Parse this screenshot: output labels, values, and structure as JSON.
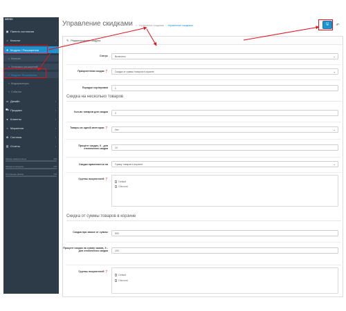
{
  "sidebar": {
    "menu_label": "МЕНЮ",
    "items": [
      {
        "label": "Панель состояния",
        "icon": "dashboard-icon",
        "glyph": "▣"
      },
      {
        "label": "Каталог",
        "icon": "tag-icon",
        "glyph": "⌂"
      },
      {
        "label": "Модули / Расширения",
        "icon": "puzzle-icon",
        "glyph": "✚"
      },
      {
        "label": "Дизайн",
        "icon": "monitor-icon",
        "glyph": "▭"
      },
      {
        "label": "Продажи",
        "icon": "cart-icon",
        "glyph": "⛟"
      },
      {
        "label": "Клиенты",
        "icon": "user-icon",
        "glyph": "●"
      },
      {
        "label": "Маркетинг",
        "icon": "share-icon",
        "glyph": "<"
      },
      {
        "label": "Система",
        "icon": "gear-icon",
        "glyph": "✿"
      },
      {
        "label": "Отчеты",
        "icon": "bar-chart-icon",
        "glyph": "▥"
      }
    ],
    "sub_items": [
      {
        "label": "Магазин"
      },
      {
        "label": "Установка расширений"
      },
      {
        "label": "Модули / Расширения"
      },
      {
        "label": "Модификаторы"
      },
      {
        "label": "События"
      }
    ],
    "stats": [
      {
        "label": "Заказы завершенные",
        "percent": "0%",
        "fill": 0
      },
      {
        "label": "Заказы в процессе",
        "percent": "0%",
        "fill": 0
      },
      {
        "label": "Остальные заказы",
        "percent": "0%",
        "fill": 0
      }
    ]
  },
  "header": {
    "title": "Управление скидками",
    "breadcrumb_parent": "Управление скидками",
    "breadcrumb_current": "Управление скидками",
    "save_glyph": "🖫",
    "back_glyph": "↶"
  },
  "panel": {
    "heading": "Редактирование модуля",
    "status_label": "Статус",
    "status_value": "Включено",
    "priority_label": "Приоритетная скидка",
    "priority_value": "Скидка от суммы товаров в корзине",
    "sort_label": "Порядок сортировки",
    "sort_value": "1",
    "section1_title": "Скидка на несколько товаров",
    "qty_label": "Кол-во товаров для скидки",
    "qty_value": "2",
    "same_cat_label": "Товары из одной категории",
    "same_cat_value": "Нет",
    "percent_label": "Процент скидки, Х - для отключения скидки",
    "percent_value": "10",
    "apply_label": "Скидка применяется на",
    "apply_value": "Сумму товаров в корзине",
    "groups_label": "Группы покупателей",
    "groups": [
      "Default",
      "Discount"
    ],
    "section2_title": "Скидка от суммы товаров в корзине",
    "order_sum_label": "Скидка при заказе от суммы",
    "order_sum_value": "500",
    "sum_percent_label": "Процент скидки на сумму заказа, Х - для отключения скидки",
    "sum_percent_value": "100",
    "groups2_label": "Группы покупателей",
    "groups2": [
      "Default",
      "Discount"
    ]
  },
  "colors": {
    "accent": "#1e91cf",
    "sidebar": "#2d3b48",
    "highlight": "#e2131d"
  }
}
